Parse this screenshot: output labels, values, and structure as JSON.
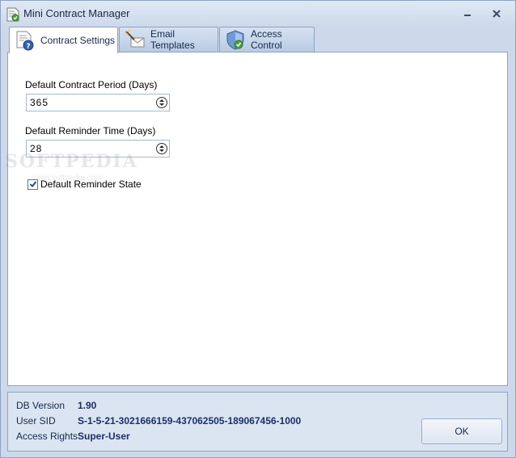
{
  "window": {
    "title": "Mini Contract Manager"
  },
  "tabs": [
    {
      "label": "Contract Settings",
      "icon": "contract-settings-icon",
      "active": true
    },
    {
      "label": "Email Templates",
      "icon": "email-templates-icon",
      "active": false
    },
    {
      "label": "Access Control",
      "icon": "shield-icon",
      "active": false
    }
  ],
  "settings": {
    "contract_period_label": "Default Contract Period (Days)",
    "contract_period_value": "365",
    "reminder_time_label": "Default Reminder Time (Days)",
    "reminder_time_value": "28",
    "reminder_state_label": "Default Reminder State",
    "reminder_state_checked": true
  },
  "watermark": {
    "text": "SOFTPEDIA",
    "sub": "www.softpedia.com"
  },
  "info": {
    "db_version_label": "DB Version",
    "db_version_value": "1.90",
    "user_sid_label": "User SID",
    "user_sid_value": "S-1-5-21-3021666159-437062505-189067456-1000",
    "access_rights_label": "Access Rights",
    "access_rights_value": "Super-User"
  },
  "buttons": {
    "ok_label": "OK"
  },
  "colors": {
    "accent": "#1c2f6b",
    "frame": "#cdd9ea",
    "border": "#8ea3c1"
  }
}
